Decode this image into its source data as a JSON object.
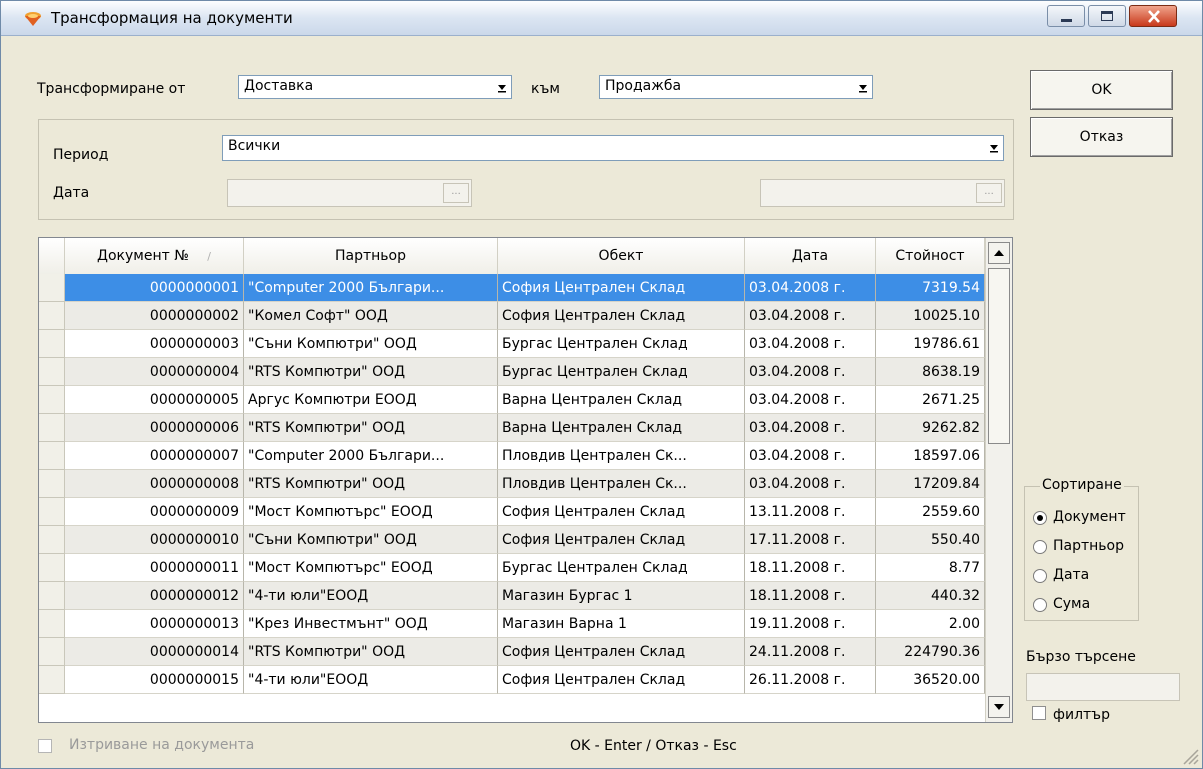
{
  "window": {
    "title": "Трансформация на документи"
  },
  "transform": {
    "from_label": "Трансформиране от",
    "from_value": "Доставка",
    "to_label": "към",
    "to_value": "Продажба"
  },
  "buttons": {
    "ok": "OK",
    "cancel": "Отказ"
  },
  "period": {
    "label": "Период",
    "value": "Всички"
  },
  "date": {
    "label": "Дата",
    "from": "",
    "to": ""
  },
  "grid": {
    "columns": [
      "Документ №",
      "Партньор",
      "Обект",
      "Дата",
      "Стойност"
    ],
    "rows": [
      {
        "doc": "0000000001",
        "partner": "\"Computer 2000  Българи...",
        "object": "София Централен Склад",
        "date": "03.04.2008 г.",
        "value": "7319.54"
      },
      {
        "doc": "0000000002",
        "partner": "\"Комел Софт\" ООД",
        "object": "София Централен Склад",
        "date": "03.04.2008 г.",
        "value": "10025.10"
      },
      {
        "doc": "0000000003",
        "partner": "\"Съни Компютри\" ООД",
        "object": "Бургас Централен Склад",
        "date": "03.04.2008 г.",
        "value": "19786.61"
      },
      {
        "doc": "0000000004",
        "partner": "\"RTS Компютри\" ООД",
        "object": "Бургас Централен Склад",
        "date": "03.04.2008 г.",
        "value": "8638.19"
      },
      {
        "doc": "0000000005",
        "partner": "Аргус Компютри ЕООД",
        "object": "Варна Централен Склад",
        "date": "03.04.2008 г.",
        "value": "2671.25"
      },
      {
        "doc": "0000000006",
        "partner": "\"RTS Компютри\" ООД",
        "object": "Варна Централен Склад",
        "date": "03.04.2008 г.",
        "value": "9262.82"
      },
      {
        "doc": "0000000007",
        "partner": "\"Computer 2000  Българи...",
        "object": "Пловдив Централен Ск...",
        "date": "03.04.2008 г.",
        "value": "18597.06"
      },
      {
        "doc": "0000000008",
        "partner": "\"RTS Компютри\" ООД",
        "object": "Пловдив Централен Ск...",
        "date": "03.04.2008 г.",
        "value": "17209.84"
      },
      {
        "doc": "0000000009",
        "partner": "\"Мост Компютърс\" ЕООД",
        "object": "София Централен Склад",
        "date": "13.11.2008 г.",
        "value": "2559.60"
      },
      {
        "doc": "0000000010",
        "partner": "\"Съни Компютри\" ООД",
        "object": "София Централен Склад",
        "date": "17.11.2008 г.",
        "value": "550.40"
      },
      {
        "doc": "0000000011",
        "partner": "\"Мост Компютърс\" ЕООД",
        "object": "Бургас Централен Склад",
        "date": "18.11.2008 г.",
        "value": "8.77"
      },
      {
        "doc": "0000000012",
        "partner": "\"4-ти юли\"ЕООД",
        "object": "Магазин Бургас 1",
        "date": "18.11.2008 г.",
        "value": "440.32"
      },
      {
        "doc": "0000000013",
        "partner": "\"Крез Инвестмънт\" ООД",
        "object": "Магазин Варна 1",
        "date": "19.11.2008 г.",
        "value": "2.00"
      },
      {
        "doc": "0000000014",
        "partner": "\"RTS Компютри\" ООД",
        "object": "София Централен Склад",
        "date": "24.11.2008 г.",
        "value": "224790.36"
      },
      {
        "doc": "0000000015",
        "partner": "\"4-ти юли\"ЕООД",
        "object": "София Централен Склад",
        "date": "26.11.2008 г.",
        "value": "36520.00"
      }
    ]
  },
  "sort": {
    "title": "Сортиране",
    "options": [
      "Документ",
      "Партньор",
      "Дата",
      "Сума"
    ],
    "selected": "Документ"
  },
  "quick_search": {
    "label": "Бързо търсене",
    "value": "",
    "filter_label": "филтър"
  },
  "footer": {
    "delete_label": "Изтриване на документа",
    "hint": "OK - Enter / Отказ - Esc"
  }
}
